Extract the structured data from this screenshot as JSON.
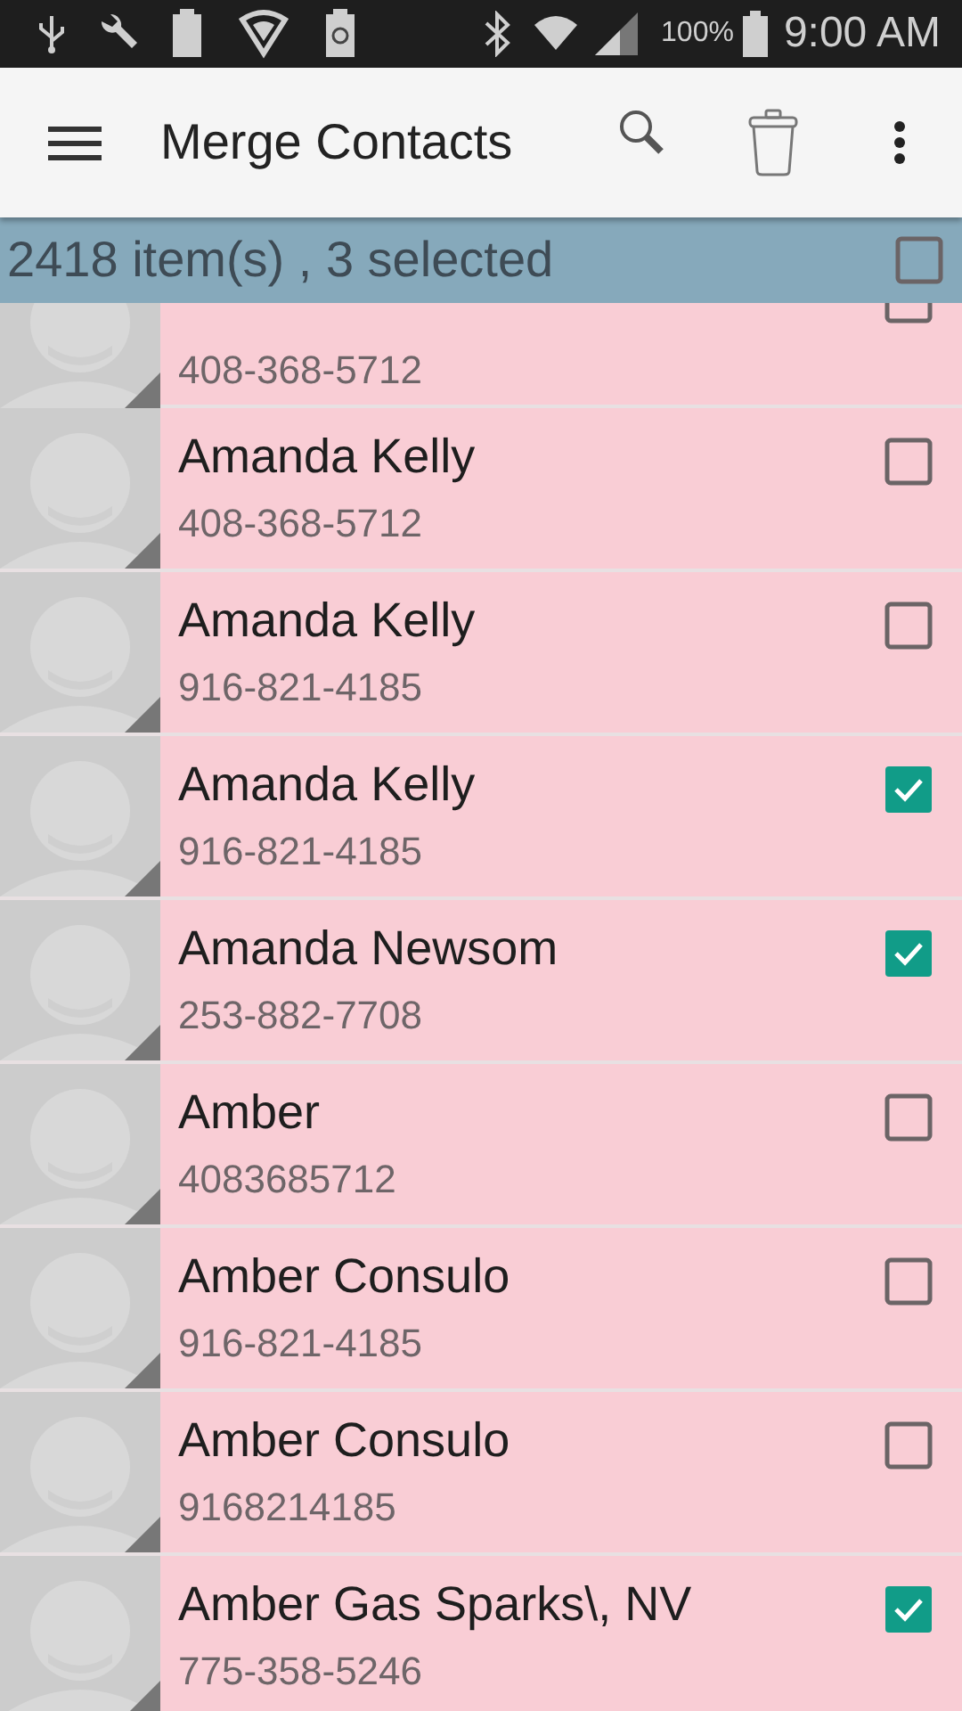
{
  "status_bar": {
    "battery_percent": "100%",
    "time": "9:00 AM"
  },
  "app_bar": {
    "title": "Merge Contacts"
  },
  "selection_bar": {
    "summary": "2418 item(s) , 3 selected",
    "checked": false
  },
  "contacts": [
    {
      "phone": "408-368-5712",
      "checked": false
    },
    {
      "name": "Amanda Kelly",
      "phone": "408-368-5712",
      "checked": false
    },
    {
      "name": "Amanda Kelly",
      "phone": "916-821-4185",
      "checked": false
    },
    {
      "name": "Amanda Kelly",
      "phone": "916-821-4185",
      "checked": true
    },
    {
      "name": "Amanda Newsom",
      "phone": "253-882-7708",
      "checked": true
    },
    {
      "name": "Amber",
      "phone": "4083685712",
      "checked": false
    },
    {
      "name": "Amber Consulo",
      "phone": "916-821-4185",
      "checked": false
    },
    {
      "name": "Amber Consulo",
      "phone": "9168214185",
      "checked": false
    },
    {
      "name": "Amber Gas Sparks\\, NV",
      "phone": "775-358-5246",
      "checked": true
    }
  ]
}
